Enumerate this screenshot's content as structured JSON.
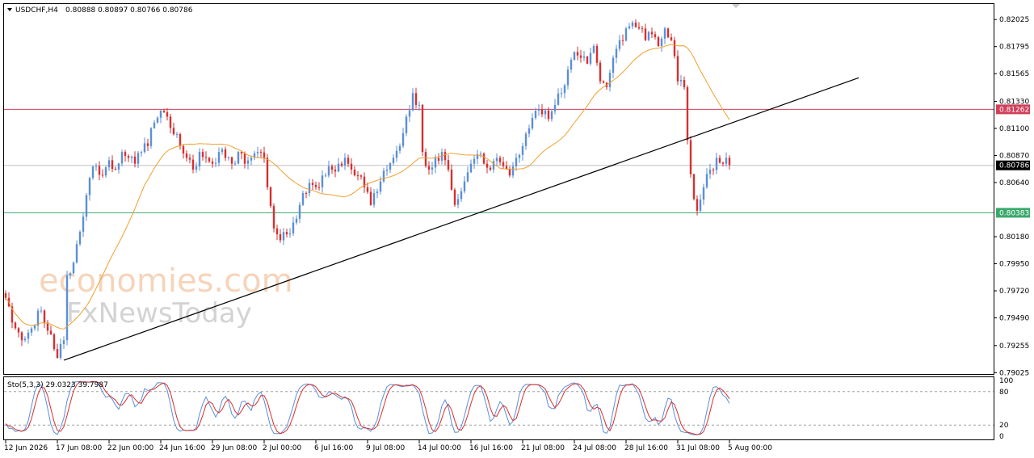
{
  "chart_data": {
    "type": "candlestick",
    "header": {
      "symbol_label": "USDCHF,H4",
      "ohlc_label": "0.80888 0.80897 0.80766 0.80786"
    },
    "price_axis": {
      "ylim": [
        0.7902,
        0.8215
      ],
      "ticks": [
        "0.82025",
        "0.81795",
        "0.81565",
        "0.81330",
        "0.81100",
        "0.80870",
        "0.80640",
        "0.80180",
        "0.79950",
        "0.79720",
        "0.79490",
        "0.79255",
        "0.79025"
      ]
    },
    "time_axis": {
      "labels": [
        "12 Jun 2026",
        "17 Jun 08:00",
        "22 Jun 00:00",
        "24 Jun 16:00",
        "29 Jun 08:00",
        "2 Jul 00:00",
        "6 Jul 16:00",
        "9 Jul 08:00",
        "14 Jul 00:00",
        "16 Jul 16:00",
        "21 Jul 08:00",
        "24 Jul 08:00",
        "28 Jul 16:00",
        "31 Jul 08:00",
        "5 Aug 00:00"
      ],
      "label_bar_index": [
        0,
        16,
        32,
        48,
        64,
        80,
        96,
        112,
        128,
        144,
        160,
        176,
        192,
        208,
        224
      ]
    },
    "bar_count": 225,
    "anchors": [
      [
        0,
        0.7966
      ],
      [
        2,
        0.7945
      ],
      [
        5,
        0.793
      ],
      [
        8,
        0.794
      ],
      [
        10,
        0.7955
      ],
      [
        12,
        0.7945
      ],
      [
        14,
        0.7935
      ],
      [
        16,
        0.7915
      ],
      [
        18,
        0.793
      ],
      [
        19,
        0.7985
      ],
      [
        21,
        0.7996
      ],
      [
        24,
        0.8035
      ],
      [
        26,
        0.8068
      ],
      [
        28,
        0.8078
      ],
      [
        30,
        0.807
      ],
      [
        32,
        0.8083
      ],
      [
        34,
        0.8075
      ],
      [
        36,
        0.809
      ],
      [
        38,
        0.8085
      ],
      [
        40,
        0.808
      ],
      [
        42,
        0.809
      ],
      [
        44,
        0.8095
      ],
      [
        46,
        0.8115
      ],
      [
        48,
        0.8125
      ],
      [
        50,
        0.812
      ],
      [
        52,
        0.8105
      ],
      [
        54,
        0.8095
      ],
      [
        56,
        0.8085
      ],
      [
        58,
        0.8075
      ],
      [
        60,
        0.809
      ],
      [
        62,
        0.8085
      ],
      [
        64,
        0.808
      ],
      [
        66,
        0.809
      ],
      [
        68,
        0.8085
      ],
      [
        70,
        0.808
      ],
      [
        72,
        0.809
      ],
      [
        74,
        0.808
      ],
      [
        76,
        0.8085
      ],
      [
        78,
        0.809
      ],
      [
        80,
        0.8085
      ],
      [
        81,
        0.806
      ],
      [
        83,
        0.8025
      ],
      [
        85,
        0.8015
      ],
      [
        87,
        0.802
      ],
      [
        89,
        0.803
      ],
      [
        91,
        0.8045
      ],
      [
        93,
        0.8055
      ],
      [
        95,
        0.8062
      ],
      [
        97,
        0.806
      ],
      [
        99,
        0.807
      ],
      [
        101,
        0.8075
      ],
      [
        103,
        0.808
      ],
      [
        105,
        0.8085
      ],
      [
        107,
        0.8075
      ],
      [
        109,
        0.807
      ],
      [
        111,
        0.806
      ],
      [
        113,
        0.8045
      ],
      [
        114,
        0.8055
      ],
      [
        116,
        0.8065
      ],
      [
        118,
        0.8075
      ],
      [
        120,
        0.8085
      ],
      [
        122,
        0.8095
      ],
      [
        124,
        0.812
      ],
      [
        126,
        0.814
      ],
      [
        128,
        0.813
      ],
      [
        129,
        0.809
      ],
      [
        131,
        0.8075
      ],
      [
        133,
        0.8085
      ],
      [
        135,
        0.809
      ],
      [
        137,
        0.8075
      ],
      [
        139,
        0.8045
      ],
      [
        140,
        0.805
      ],
      [
        142,
        0.8065
      ],
      [
        144,
        0.808
      ],
      [
        146,
        0.8088
      ],
      [
        148,
        0.808
      ],
      [
        150,
        0.8075
      ],
      [
        152,
        0.8085
      ],
      [
        154,
        0.8078
      ],
      [
        156,
        0.807
      ],
      [
        158,
        0.8085
      ],
      [
        160,
        0.8095
      ],
      [
        162,
        0.811
      ],
      [
        164,
        0.8125
      ],
      [
        166,
        0.8122
      ],
      [
        168,
        0.8118
      ],
      [
        170,
        0.813
      ],
      [
        172,
        0.814
      ],
      [
        174,
        0.816
      ],
      [
        176,
        0.8175
      ],
      [
        178,
        0.817
      ],
      [
        180,
        0.8165
      ],
      [
        182,
        0.818
      ],
      [
        184,
        0.815
      ],
      [
        186,
        0.8145
      ],
      [
        188,
        0.817
      ],
      [
        190,
        0.8185
      ],
      [
        192,
        0.8195
      ],
      [
        194,
        0.82
      ],
      [
        196,
        0.8195
      ],
      [
        198,
        0.8185
      ],
      [
        200,
        0.819
      ],
      [
        202,
        0.818
      ],
      [
        204,
        0.8195
      ],
      [
        206,
        0.8185
      ],
      [
        208,
        0.815
      ],
      [
        210,
        0.8145
      ],
      [
        211,
        0.81
      ],
      [
        213,
        0.805
      ],
      [
        214,
        0.804
      ],
      [
        216,
        0.806
      ],
      [
        218,
        0.8075
      ],
      [
        220,
        0.8085
      ],
      [
        222,
        0.808
      ],
      [
        223,
        0.8085
      ],
      [
        224,
        0.8079
      ]
    ],
    "indicators": {
      "moving_average": {
        "color": "#f0a030"
      },
      "trendline": {
        "color": "#000000",
        "from": [
          18,
          0.7913
        ],
        "to": [
          264,
          0.8153
        ]
      },
      "resistance": {
        "value": 0.81262,
        "label": "0.81262",
        "color": "#d0405a"
      },
      "support": {
        "value": 0.80383,
        "label": "0.80383",
        "color": "#3aa86b"
      },
      "current": {
        "value": 0.80786,
        "label": "0.80786",
        "color": "#000000"
      }
    },
    "colors": {
      "bull": "#5b8fd6",
      "bear": "#d62f2f"
    }
  },
  "stochastic": {
    "label": "Sto(5,3,3) 29.0323 39.7987",
    "ticks": [
      "100",
      "80",
      "20",
      "0"
    ],
    "levels": [
      80,
      20
    ],
    "k_color": "#5b8fd6",
    "d_color": "#d62f2f"
  },
  "watermark": {
    "line1": "economies.com",
    "line2": "FxNewsToday"
  }
}
